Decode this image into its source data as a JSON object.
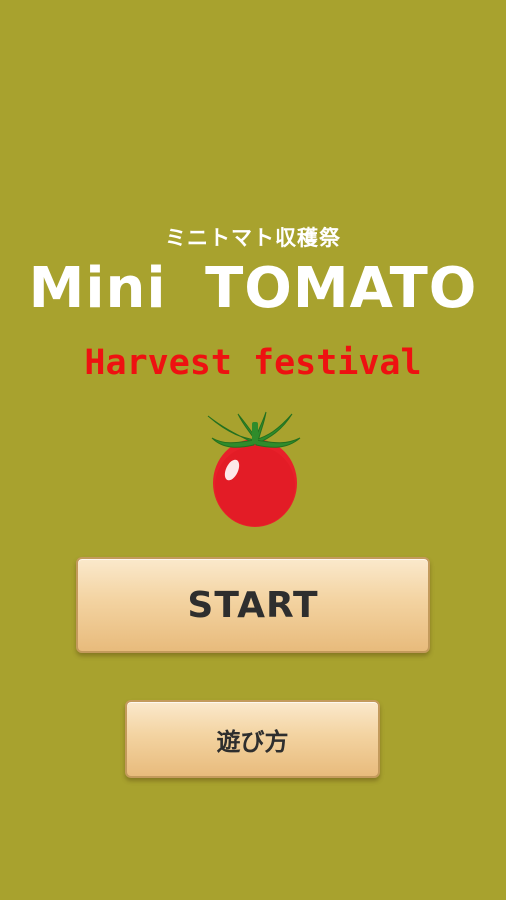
{
  "title_screen": {
    "subtitle_jp": "ミニトマト収穫祭",
    "title": "Mini TOMATO",
    "subtitle_en": "Harvest festival"
  },
  "buttons": {
    "start_label": "START",
    "howto_label": "遊び方"
  },
  "icons": {
    "tomato": "tomato-icon"
  },
  "colors": {
    "background": "#a8a22e",
    "title_text": "#ffffff",
    "subtitle_en": "#ee1111",
    "tomato": "#e8202a",
    "tomato_stem": "#2e8a2a",
    "button_face": "#f3d3a1"
  }
}
